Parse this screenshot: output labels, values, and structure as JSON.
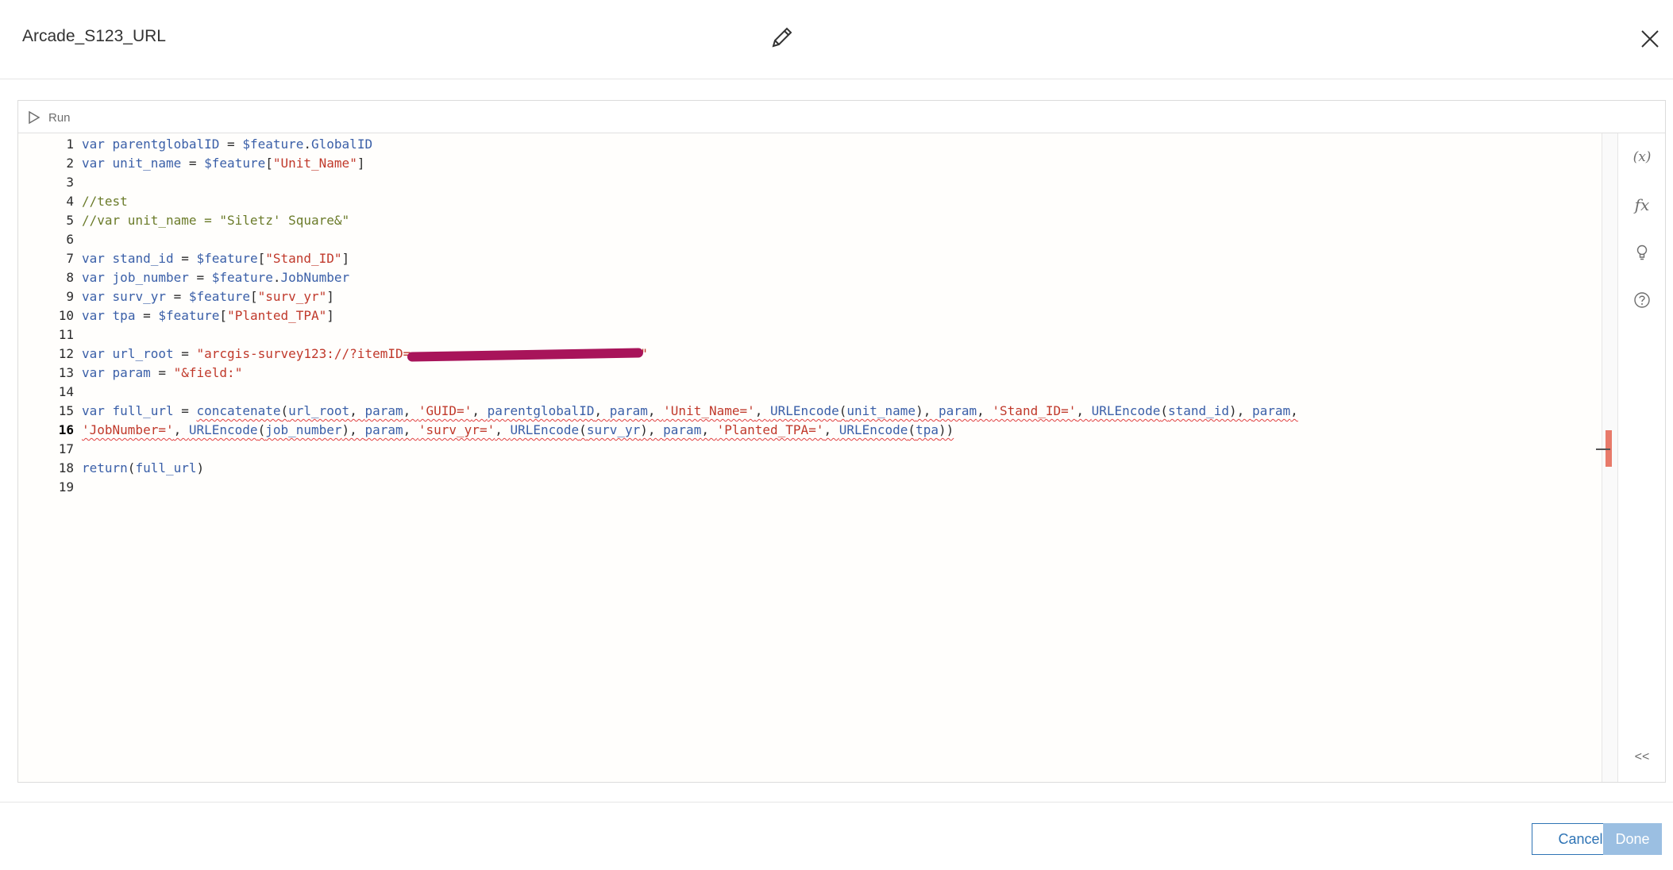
{
  "window": {
    "title": "Arcade_S123_URL"
  },
  "toolbar": {
    "run_label": "Run"
  },
  "editor": {
    "active_line": 16,
    "line_numbers": [
      "1",
      "2",
      "3",
      "4",
      "5",
      "6",
      "7",
      "8",
      "9",
      "10",
      "11",
      "12",
      "13",
      "14",
      "15",
      "16",
      "17",
      "18",
      "19"
    ],
    "lines": [
      "var parentglobalID = $feature.GlobalID",
      "var unit_name = $feature[\"Unit_Name\"]",
      "",
      "//test",
      "//var unit_name = \"Siletz' Square&\"",
      "",
      "var stand_id = $feature[\"Stand_ID\"]",
      "var job_number = $feature.JobNumber",
      "var surv_yr = $feature[\"surv_yr\"]",
      "var tpa = $feature[\"Planted_TPA\"]",
      "",
      "var url_root = \"arcgis-survey123://?itemID=",
      "var param = \"&field:\"",
      "",
      "var full_url = concatenate(url_root, param, 'GUID=', parentglobalID, param, 'Unit_Name=', URLEncode(unit_name), param, 'Stand_ID=', URLEncode(stand_id), param,",
      "'JobNumber=', URLEncode(job_number), param, 'surv_yr=', URLEncode(surv_yr), param, 'Planted_TPA=', URLEncode(tpa))",
      "",
      "return(full_url)",
      ""
    ]
  },
  "side_panel": {
    "items": [
      {
        "label": "(x)",
        "icon": "variables-icon"
      },
      {
        "label": "fx",
        "icon": "functions-icon"
      },
      {
        "label": "",
        "icon": "suggestions-icon"
      },
      {
        "label": "",
        "icon": "help-icon"
      }
    ],
    "collapse_label": "<<"
  },
  "footer": {
    "cancel_label": "Cancel",
    "done_label": "Done"
  },
  "colors": {
    "accent": "#2f74b5",
    "done_disabled": "#9bbfe2",
    "error": "#e04040",
    "keyword": "#3a5fa8",
    "string": "#c0392b",
    "comment": "#6b7b2a"
  }
}
